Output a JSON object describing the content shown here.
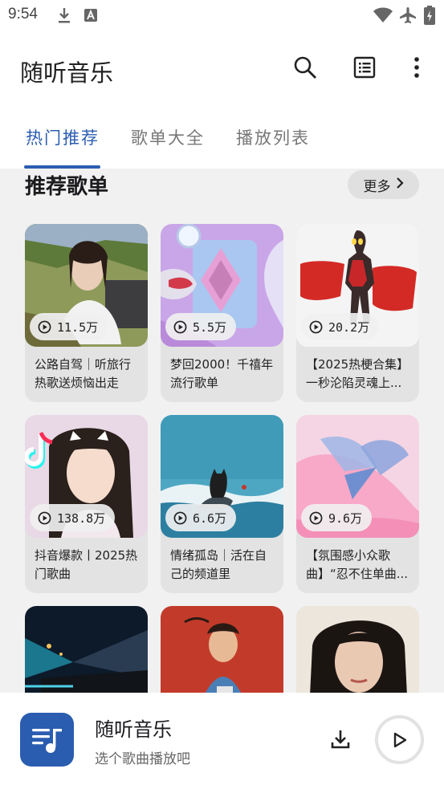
{
  "status_bar": {
    "time": "9:54",
    "icons": [
      "download-icon",
      "a-icon",
      "wifi-icon",
      "airplane-icon",
      "battery-icon"
    ]
  },
  "app_bar": {
    "title": "随听音乐",
    "actions": [
      "search-icon",
      "list-icon",
      "more-vert-icon"
    ]
  },
  "tabs": [
    {
      "label": "热门推荐",
      "active": true
    },
    {
      "label": "歌单大全",
      "active": false
    },
    {
      "label": "播放列表",
      "active": false
    }
  ],
  "section": {
    "title": "推荐歌单",
    "more_label": "更多"
  },
  "playlists": [
    {
      "plays": "11.5万",
      "title": "公路自驾｜听旅行热歌送烦恼出走"
    },
    {
      "plays": "5.5万",
      "title": "梦回2000！千禧年流行歌单"
    },
    {
      "plays": "20.2万",
      "title": "【2025热梗合集】一秒沦陷灵魂上..."
    },
    {
      "plays": "138.8万",
      "title": "抖音爆款丨2025热门歌曲"
    },
    {
      "plays": "6.6万",
      "title": "情绪孤岛｜活在自己的频道里"
    },
    {
      "plays": "9.6万",
      "title": "【氛围感小众歌曲】“忍不住单曲..."
    },
    {
      "plays": "",
      "title": ""
    },
    {
      "plays": "",
      "title": ""
    },
    {
      "plays": "",
      "title": ""
    }
  ],
  "player": {
    "title": "随听音乐",
    "subtitle": "选个歌曲播放吧"
  },
  "colors": {
    "accent": "#2a5db0",
    "content_bg": "#f1f1f1",
    "card_bg": "#e3e3e3"
  }
}
